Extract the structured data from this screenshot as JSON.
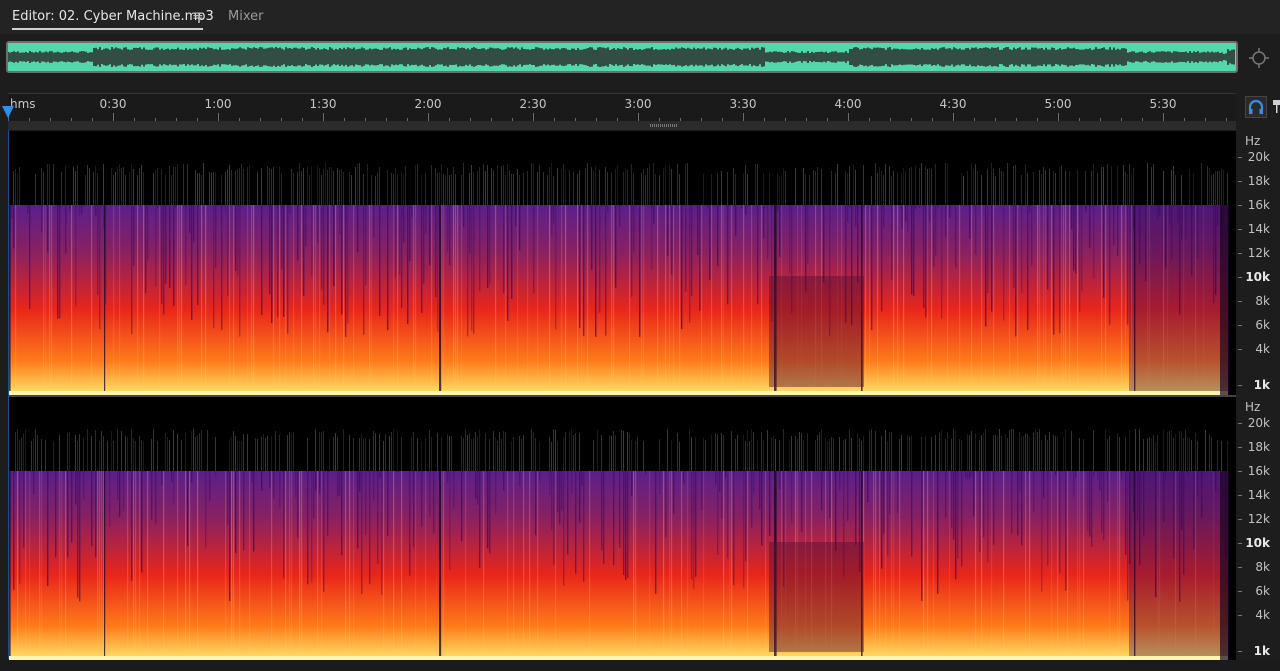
{
  "editor_tab": {
    "label": "Editor: 02. Cyber Machine.mp3"
  },
  "mixer_tab": {
    "label": "Mixer"
  },
  "icons": {
    "menu": "hamburger-icon",
    "zoom": "zoom-navigator-icon",
    "monitor": "headphones-icon",
    "pin": "pin-icon"
  },
  "ruler": {
    "labels": [
      "hms",
      "0:30",
      "1:00",
      "1:30",
      "2:00",
      "2:30",
      "3:00",
      "3:30",
      "4:00",
      "4:30",
      "5:00",
      "5:30"
    ]
  },
  "frequency_axis": {
    "unit": "Hz",
    "labels": [
      "20k",
      "18k",
      "16k",
      "14k",
      "12k",
      "10k",
      "8k",
      "6k",
      "4k",
      "1k"
    ]
  },
  "colors": {
    "waveform_bg": "#52d8aa",
    "waveform": "#2b2b2b",
    "playhead": "#2f8fe6",
    "spectral_low": "#ffe46a",
    "spectral_mid": "#e8261a",
    "spectral_high": "#5a1f8c"
  }
}
